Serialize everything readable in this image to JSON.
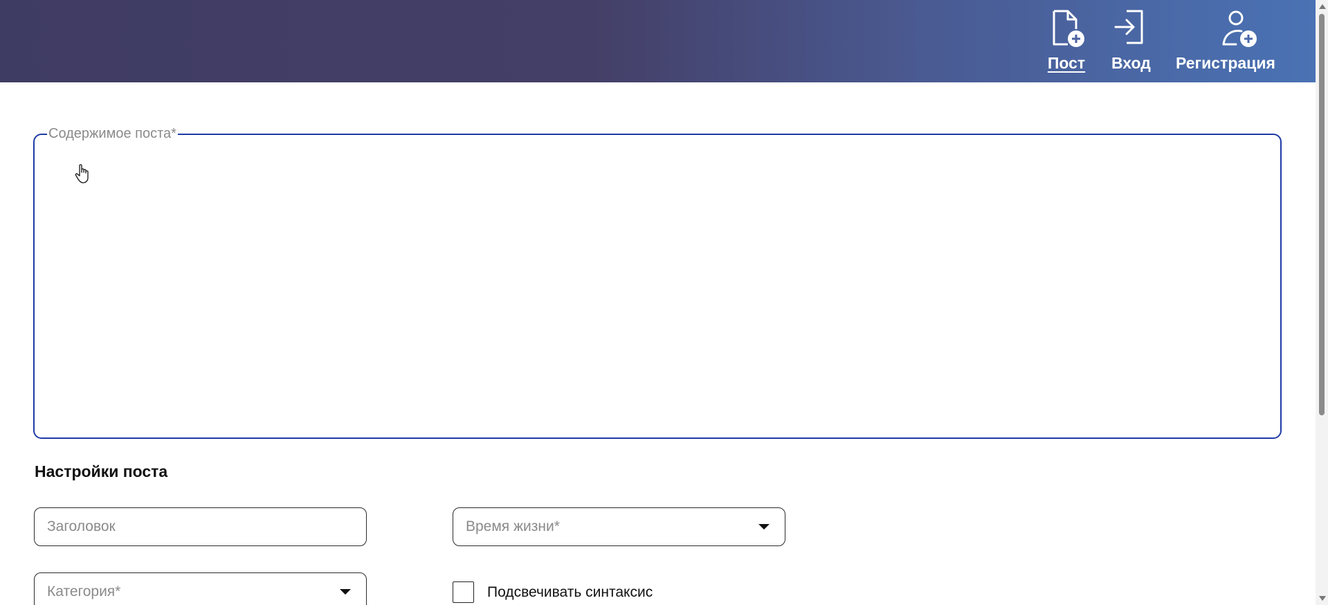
{
  "header": {
    "nav": [
      {
        "label": "Пост",
        "icon": "file-plus-icon",
        "active": true
      },
      {
        "label": "Вход",
        "icon": "login-icon",
        "active": false
      },
      {
        "label": "Регистрация",
        "icon": "user-plus-icon",
        "active": false
      }
    ]
  },
  "content": {
    "legend": "Содержимое поста*"
  },
  "settings": {
    "title": "Настройки поста",
    "title_field_placeholder": "Заголовок",
    "lifetime_placeholder": "Время жизни*",
    "category_placeholder": "Категория*",
    "syntax_highlight_label": "Подсвечивать синтаксис"
  },
  "colors": {
    "header_gradient_start": "#3f3c64",
    "header_gradient_end": "#4a72b4",
    "field_focus_border": "#1f3aa5"
  }
}
